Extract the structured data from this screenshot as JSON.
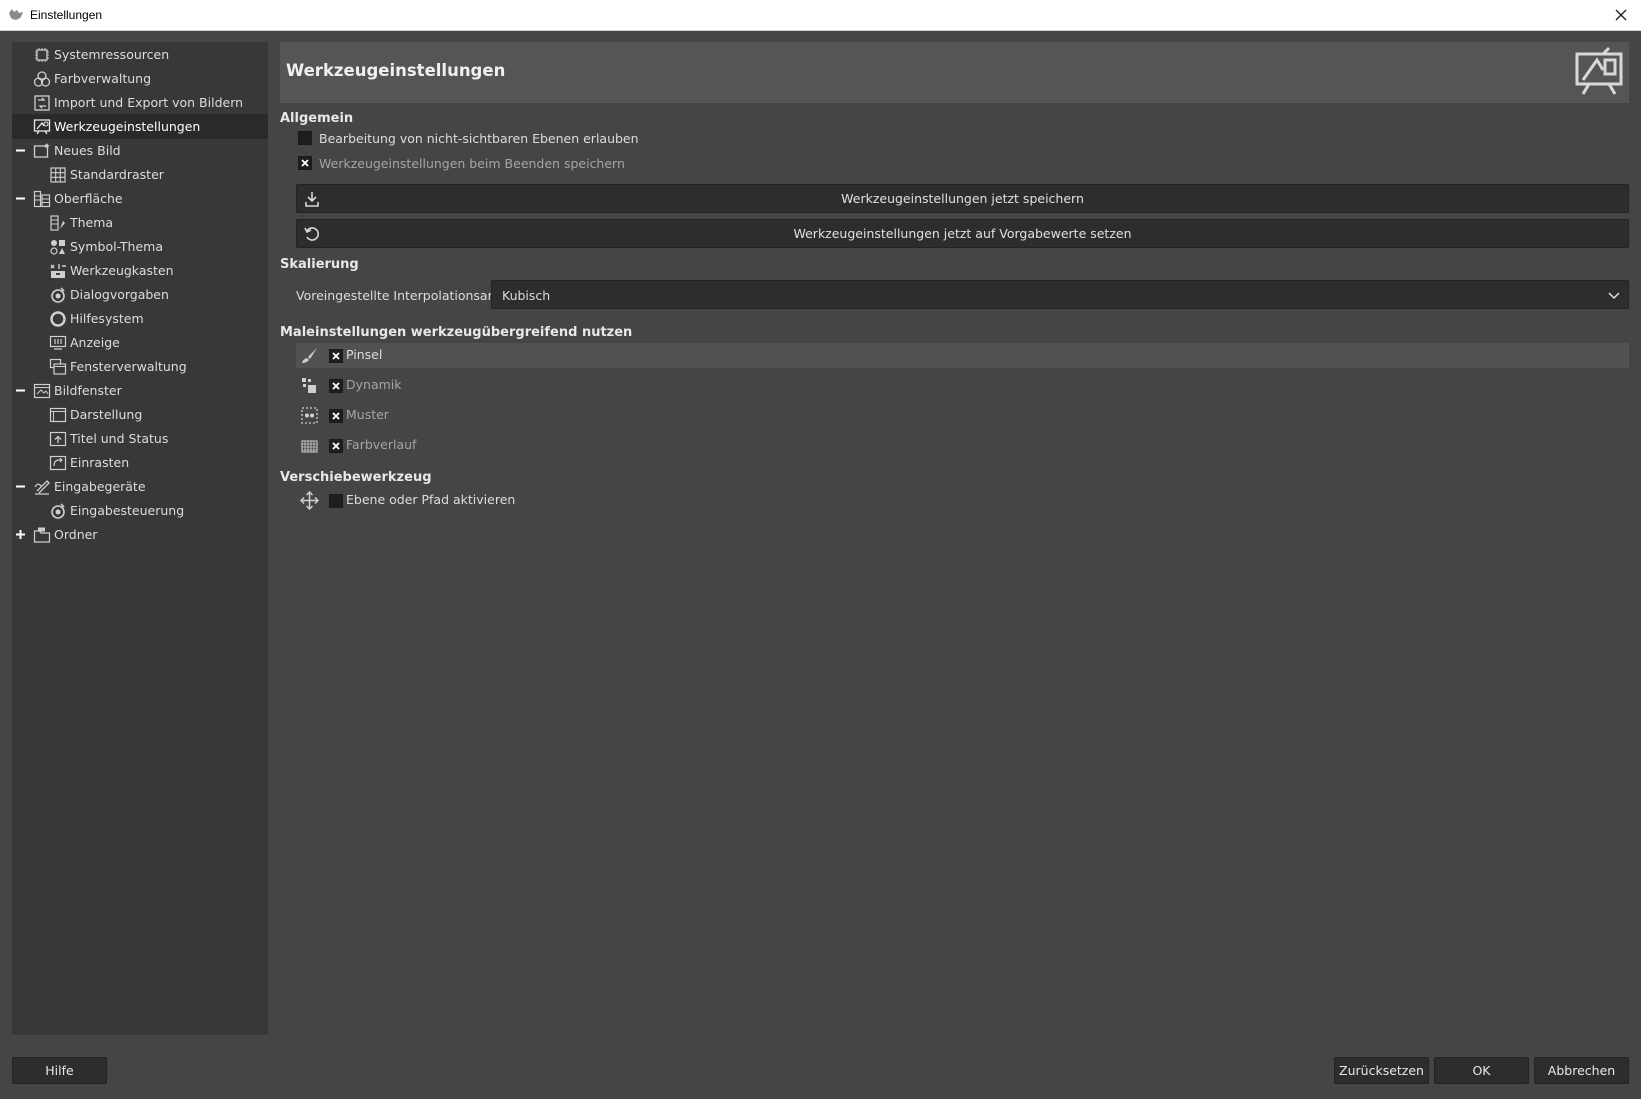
{
  "window": {
    "title": "Einstellungen"
  },
  "sidebar": {
    "items": [
      {
        "label": "Systemressourcen",
        "icon": "chip-icon"
      },
      {
        "label": "Farbverwaltung",
        "icon": "color-circles-icon"
      },
      {
        "label": "Import und Export von Bildern",
        "icon": "import-export-icon"
      },
      {
        "label": "Werkzeugeinstellungen",
        "icon": "tool-options-icon",
        "selected": true
      },
      {
        "label": "Neues Bild",
        "icon": "new-image-icon",
        "expanded": true
      },
      {
        "label": "Standardraster",
        "icon": "grid-icon"
      },
      {
        "label": "Oberfläche",
        "icon": "interface-icon",
        "expanded": true
      },
      {
        "label": "Thema",
        "icon": "theme-icon"
      },
      {
        "label": "Symbol-Thema",
        "icon": "icon-theme-icon"
      },
      {
        "label": "Werkzeugkasten",
        "icon": "toolbox-icon"
      },
      {
        "label": "Dialogvorgaben",
        "icon": "dialog-defaults-icon"
      },
      {
        "label": "Hilfesystem",
        "icon": "lifebuoy-icon"
      },
      {
        "label": "Anzeige",
        "icon": "display-icon"
      },
      {
        "label": "Fensterverwaltung",
        "icon": "window-management-icon"
      },
      {
        "label": "Bildfenster",
        "icon": "image-window-icon",
        "expanded": true
      },
      {
        "label": "Darstellung",
        "icon": "appearance-icon"
      },
      {
        "label": "Titel und Status",
        "icon": "title-status-icon"
      },
      {
        "label": "Einrasten",
        "icon": "snapping-icon"
      },
      {
        "label": "Eingabegeräte",
        "icon": "input-devices-icon",
        "expanded": true
      },
      {
        "label": "Eingabesteuerung",
        "icon": "input-controllers-icon"
      },
      {
        "label": "Ordner",
        "icon": "folders-icon",
        "expanded": false
      }
    ]
  },
  "header": {
    "title": "Werkzeugeinstellungen"
  },
  "general": {
    "title": "Allgemein",
    "edit_invisible_label": "Bearbeitung von nicht-sichtbaren Ebenen erlauben",
    "edit_invisible_checked": false,
    "save_on_exit_label": "Werkzeugeinstellungen beim Beenden speichern",
    "save_on_exit_checked": true,
    "save_now_label": "Werkzeugeinstellungen jetzt speichern",
    "reset_defaults_label": "Werkzeugeinstellungen jetzt auf Vorgabewerte setzen"
  },
  "scaling": {
    "title": "Skalierung",
    "interpolation_label": "Voreingestellte Interpolationsart:",
    "interpolation_value": "Kubisch"
  },
  "paint": {
    "title": "Maleinstellungen werkzeugübergreifend nutzen",
    "items": [
      {
        "label": "Pinsel",
        "icon": "brush-icon",
        "checked": true
      },
      {
        "label": "Dynamik",
        "icon": "dynamics-icon",
        "checked": true
      },
      {
        "label": "Muster",
        "icon": "pattern-icon",
        "checked": true
      },
      {
        "label": "Farbverlauf",
        "icon": "gradient-icon",
        "checked": true
      }
    ]
  },
  "move_tool": {
    "title": "Verschiebewerkzeug",
    "activate_label": "Ebene oder Pfad aktivieren",
    "activate_checked": false
  },
  "footer": {
    "help_label": "Hilfe",
    "reset_label": "Zurücksetzen",
    "ok_label": "OK",
    "cancel_label": "Abbrechen"
  }
}
